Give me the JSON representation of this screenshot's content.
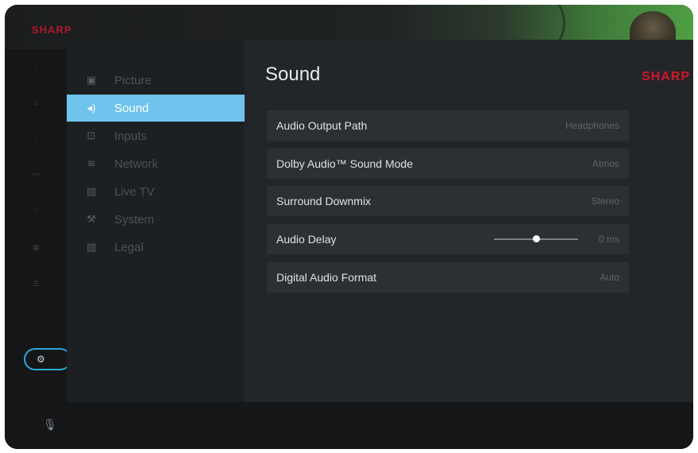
{
  "brand": {
    "top_logo": "SHARP",
    "content_logo": "SHARP",
    "color": "#d0182a"
  },
  "accent_color": "#6fc3ec",
  "focus_ring_color": "#2aa9d8",
  "categories": [
    {
      "label": "Picture",
      "icon": "picture-icon",
      "selected": false
    },
    {
      "label": "Sound",
      "icon": "speaker-icon",
      "selected": true
    },
    {
      "label": "Inputs",
      "icon": "input-icon",
      "selected": false
    },
    {
      "label": "Network",
      "icon": "wifi-icon",
      "selected": false
    },
    {
      "label": "Live TV",
      "icon": "tv-icon",
      "selected": false
    },
    {
      "label": "System",
      "icon": "wrench-icon",
      "selected": false
    },
    {
      "label": "Legal",
      "icon": "document-icon",
      "selected": false
    }
  ],
  "content": {
    "title": "Sound",
    "settings": [
      {
        "label": "Audio Output Path",
        "value": "Headphones"
      },
      {
        "label": "Dolby Audio™ Sound Mode",
        "value": "Atmos"
      },
      {
        "label": "Surround Downmix",
        "value": "Stereo"
      },
      {
        "label": "Audio Delay",
        "value": "0 ms",
        "slider_fraction": 0.5
      },
      {
        "label": "Digital Audio Format",
        "value": "Auto"
      }
    ]
  },
  "rail": {
    "icons": [
      "search-icon",
      "home-icon",
      "search-icon",
      "apps-icon",
      "favorites-icon",
      "guide-icon",
      "list-icon"
    ],
    "selected_icon": "settings-icon",
    "bottom_icon": "microphone-icon"
  }
}
